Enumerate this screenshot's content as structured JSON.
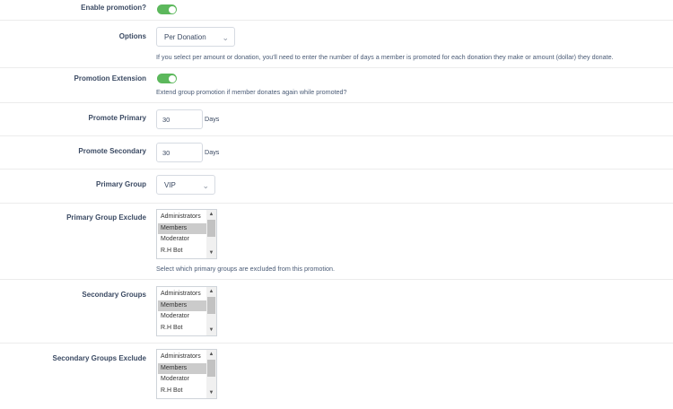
{
  "enable_promotion": {
    "label": "Enable promotion?",
    "on": true
  },
  "options": {
    "label": "Options",
    "selected": "Per Donation",
    "hint": "If you select per amount or donation, you'll need to enter the number of days a member is promoted for each donation they make or amount (dollar) they donate."
  },
  "promotion_extension": {
    "label": "Promotion Extension",
    "on": true,
    "hint": "Extend group promotion if member donates again while promoted?"
  },
  "promote_primary": {
    "label": "Promote Primary",
    "value": "30",
    "unit": "Days"
  },
  "promote_secondary": {
    "label": "Promote Secondary",
    "value": "30",
    "unit": "Days"
  },
  "primary_group": {
    "label": "Primary Group",
    "selected": "VIP"
  },
  "primary_group_exclude": {
    "label": "Primary Group Exclude",
    "options": [
      "Administrators",
      "Members",
      "Moderator",
      "R.H Bot"
    ],
    "selected_index": 1,
    "hint": "Select which primary groups are excluded from this promotion."
  },
  "secondary_groups": {
    "label": "Secondary Groups",
    "options": [
      "Administrators",
      "Members",
      "Moderator",
      "R.H Bot"
    ],
    "selected_index": 1
  },
  "secondary_groups_exclude": {
    "label": "Secondary Groups Exclude",
    "options": [
      "Administrators",
      "Members",
      "Moderator",
      "R.H Bot"
    ],
    "selected_index": 1
  },
  "icons": {
    "select_arrow": "chevron-down-icon",
    "scroll_up": "scroll-up-arrow-icon",
    "scroll_down": "scroll-down-arrow-icon"
  },
  "colors": {
    "toggle_on": "#5cb85c",
    "label_text": "#3b4a63",
    "selected_option": "#cbcbcb"
  }
}
